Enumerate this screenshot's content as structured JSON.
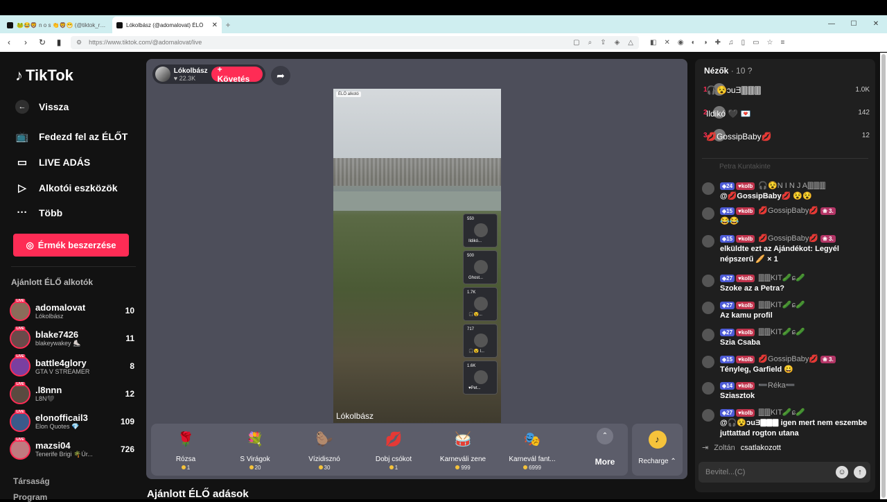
{
  "browser": {
    "tabs": [
      {
        "title": "🐸😂🦁 n o s 👏🦁😁 (@tiktok_rol..."
      },
      {
        "title": "Lókolbász (@adomalovat) ÉLŐ"
      }
    ],
    "url": "https://www.tiktok.com/@adomalovat/live",
    "new_tab": "+",
    "win_min": "—",
    "win_max": "☐",
    "win_close": "✕"
  },
  "sidebar": {
    "logo": "TikTok",
    "back": "Vissza",
    "items": [
      {
        "label": "Fedezd fel az ÉLŐT"
      },
      {
        "label": "LIVE ADÁS"
      },
      {
        "label": "Alkotói eszközök"
      },
      {
        "label": "Több"
      }
    ],
    "coins_button": "Érmék beszerzése",
    "section_title": "Ajánlott ÉLŐ alkotók",
    "live_badge": "LIVE",
    "creators": [
      {
        "name": "adomalovat",
        "sub": "Lókolbász",
        "count": "10",
        "color": "#8a6d5a"
      },
      {
        "name": "blake7426",
        "sub": "blakeywakey ⛸️",
        "count": "11",
        "color": "#6a4a4a"
      },
      {
        "name": "battle4glory",
        "sub": "GTA V STREAMER",
        "count": "8",
        "color": "#7a3fa0"
      },
      {
        "name": ".l8nnn",
        "sub": "L8N🖤",
        "count": "12",
        "color": "#5a4a40"
      },
      {
        "name": "elonofficail3",
        "sub": "Elon Quotes 💎",
        "count": "109",
        "color": "#3a5a8a"
      },
      {
        "name": "mazsi04",
        "sub": "Tenerife Brigi 🌴Úr...",
        "count": "726",
        "color": "#c07a80"
      }
    ],
    "footer1": "Társaság",
    "footer2": "Program"
  },
  "stream": {
    "host_name": "Lókolbász",
    "host_likes": "22.3K",
    "follow": "+ Követés",
    "video_tag": "ÉLŐ alkotó",
    "video_name": "Lókolbász",
    "guests": [
      {
        "count": "550",
        "name": "Ildikó..."
      },
      {
        "count": "500",
        "name": "Ghost..."
      },
      {
        "count": "1.7K",
        "name": "🎧😵..."
      },
      {
        "count": "717",
        "name": "🎧😵 l..."
      },
      {
        "count": "1.6K",
        "name": "♥Pet..."
      }
    ]
  },
  "gifts": [
    {
      "name": "Rózsa",
      "price": "1",
      "icon": "🌹"
    },
    {
      "name": "S Virágok",
      "price": "20",
      "icon": "💐"
    },
    {
      "name": "Vízidisznó",
      "price": "30",
      "icon": "🦫"
    },
    {
      "name": "Dobj csókot",
      "price": "1",
      "icon": "💋"
    },
    {
      "name": "Karneváli zene",
      "price": "999",
      "icon": "🥁"
    },
    {
      "name": "Karnevál fant...",
      "price": "6999",
      "icon": "🎭"
    }
  ],
  "more_label": "More",
  "more_icon": "⌃",
  "recharge_label": "Recharge ⌃",
  "recharge_icon": "♪",
  "section_title": "Ajánlott ÉLŐ adások",
  "viewers": {
    "title": "Nézők",
    "count": "· 10",
    "info": "?",
    "list": [
      {
        "rank": "1",
        "name": "🎧😵ɔuƎ🀫🀫🀫",
        "score": "1.0K"
      },
      {
        "rank": "2",
        "name": "Ildikó 🖤 💌",
        "score": "142"
      },
      {
        "rank": "3",
        "name": "💋GossipBaby💋",
        "score": "12"
      }
    ]
  },
  "chat": {
    "faded": "Petra Kuntakinte",
    "messages": [
      {
        "level": "24",
        "club": "kolb",
        "user": "🎧😵N I N J A🀫🀫🀫",
        "text": "@💋GossipBaby💋 😵😵"
      },
      {
        "level": "15",
        "club": "kolb",
        "user": "💋GossipBaby💋",
        "extra": "3.",
        "text": "😂😂"
      },
      {
        "level": "15",
        "club": "kolb",
        "user": "💋GossipBaby💋",
        "extra": "3.",
        "text": "elküldte ezt az Ajándékot: Legyél népszerű 🥖 × 1"
      },
      {
        "level": "27",
        "club": "kolb",
        "user": "🀫🀫KIT🥒ɕ🥒",
        "text": "Szoke az a Petra?"
      },
      {
        "level": "27",
        "club": "kolb",
        "user": "🀫🀫KIT🥒ɕ🥒",
        "text": "Az kamu profil"
      },
      {
        "level": "27",
        "club": "kolb",
        "user": "🀫🀫KIT🥒ɕ🥒",
        "text": "Szia Csaba"
      },
      {
        "level": "15",
        "club": "kolb",
        "user": "💋GossipBaby💋",
        "extra": "3.",
        "text": "Tényleg, Garfield 😀"
      },
      {
        "level": "14",
        "club": "kolb",
        "user": "➖Réka➖",
        "text": "Sziasztok"
      },
      {
        "level": "27",
        "club": "kolb",
        "user": "🀫🀫KIT🥒ɕ🥒",
        "text": "@🎧😵ɔuƎ🀫🀫🀫 igen mert nem eszembe juttattad rogton utana"
      }
    ],
    "joined_user": "Zoltán",
    "joined_text": "csatlakozott",
    "input_placeholder": "Bevitel...(C)",
    "emoji_icon": "☺",
    "send_icon": "↑"
  }
}
